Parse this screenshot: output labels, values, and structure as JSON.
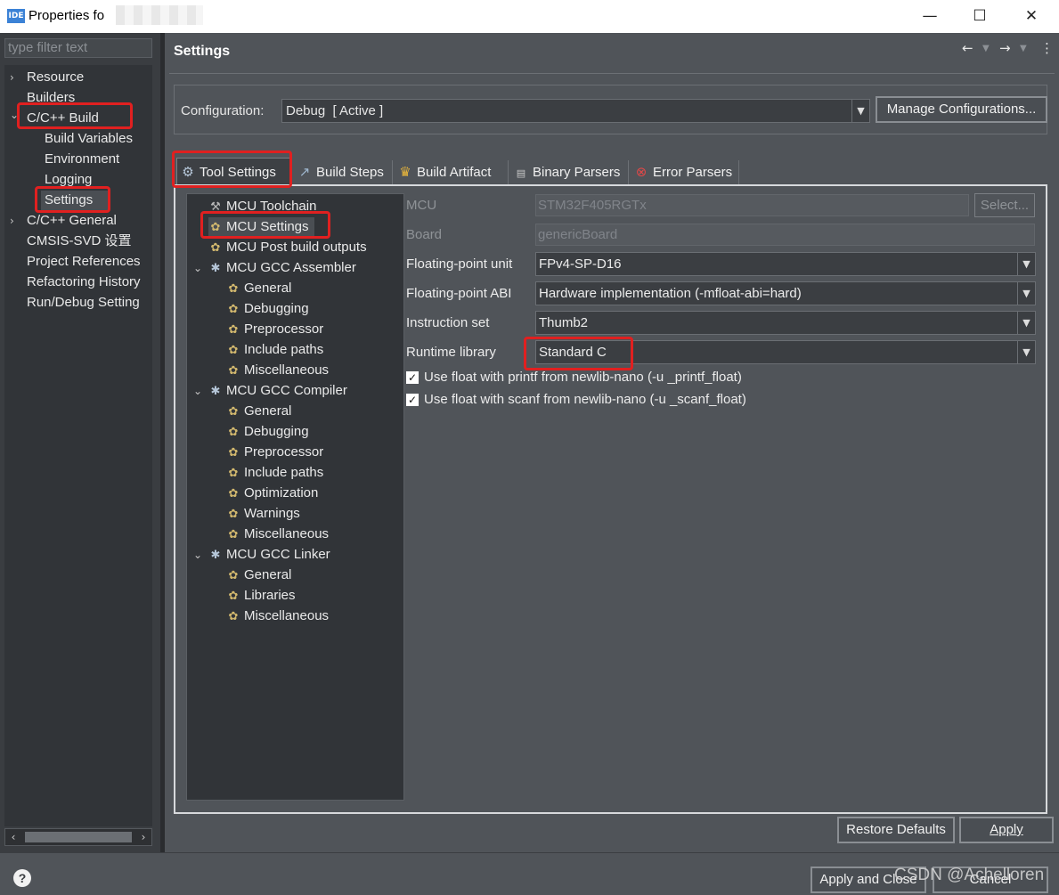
{
  "window": {
    "title": "Properties fo",
    "app_icon": "IDE",
    "controls": {
      "minimize": "—",
      "maximize": "☐",
      "close": "✕"
    }
  },
  "left": {
    "filter_placeholder": "type filter text",
    "items": [
      {
        "label": "Resource",
        "twisty": "›"
      },
      {
        "label": "Builders",
        "twisty": ""
      },
      {
        "label": "C/C++ Build",
        "twisty": "⌄"
      },
      {
        "label": "Build Variables",
        "twisty": ""
      },
      {
        "label": "Environment",
        "twisty": ""
      },
      {
        "label": "Logging",
        "twisty": ""
      },
      {
        "label": "Settings",
        "twisty": ""
      },
      {
        "label": "C/C++ General",
        "twisty": "›"
      },
      {
        "label": "CMSIS-SVD 设置",
        "twisty": ""
      },
      {
        "label": "Project References",
        "twisty": ""
      },
      {
        "label": "Refactoring History",
        "twisty": ""
      },
      {
        "label": "Run/Debug Setting",
        "twisty": ""
      }
    ]
  },
  "header": {
    "title": "Settings",
    "icons": [
      "back-arrow-icon",
      "forward-arrow-icon",
      "view-menu-icon"
    ]
  },
  "configuration": {
    "label": "Configuration:",
    "value": "Debug  [ Active ]",
    "manage_button": "Manage Configurations..."
  },
  "tabs": [
    {
      "label": "Tool Settings",
      "icon": "tool-settings-icon",
      "active": true
    },
    {
      "label": "Build Steps",
      "icon": "build-steps-icon",
      "active": false
    },
    {
      "label": "Build Artifact",
      "icon": "build-artifact-icon",
      "active": false
    },
    {
      "label": "Binary Parsers",
      "icon": "binary-parsers-icon",
      "active": false
    },
    {
      "label": "Error Parsers",
      "icon": "error-parsers-icon",
      "active": false
    }
  ],
  "tool_tree": [
    {
      "label": "MCU Toolchain",
      "icon": "hammer",
      "depth": 1,
      "twisty": ""
    },
    {
      "label": "MCU Settings",
      "icon": "gear",
      "depth": 1,
      "twisty": ""
    },
    {
      "label": "MCU Post build outputs",
      "icon": "gear",
      "depth": 1,
      "twisty": ""
    },
    {
      "label": "MCU GCC Assembler",
      "icon": "cog",
      "depth": 1,
      "twisty": "⌄"
    },
    {
      "label": "General",
      "icon": "gear",
      "depth": 2,
      "twisty": ""
    },
    {
      "label": "Debugging",
      "icon": "gear",
      "depth": 2,
      "twisty": ""
    },
    {
      "label": "Preprocessor",
      "icon": "gear",
      "depth": 2,
      "twisty": ""
    },
    {
      "label": "Include paths",
      "icon": "gear",
      "depth": 2,
      "twisty": ""
    },
    {
      "label": "Miscellaneous",
      "icon": "gear",
      "depth": 2,
      "twisty": ""
    },
    {
      "label": "MCU GCC Compiler",
      "icon": "cog",
      "depth": 1,
      "twisty": "⌄"
    },
    {
      "label": "General",
      "icon": "gear",
      "depth": 2,
      "twisty": ""
    },
    {
      "label": "Debugging",
      "icon": "gear",
      "depth": 2,
      "twisty": ""
    },
    {
      "label": "Preprocessor",
      "icon": "gear",
      "depth": 2,
      "twisty": ""
    },
    {
      "label": "Include paths",
      "icon": "gear",
      "depth": 2,
      "twisty": ""
    },
    {
      "label": "Optimization",
      "icon": "gear",
      "depth": 2,
      "twisty": ""
    },
    {
      "label": "Warnings",
      "icon": "gear",
      "depth": 2,
      "twisty": ""
    },
    {
      "label": "Miscellaneous",
      "icon": "gear",
      "depth": 2,
      "twisty": ""
    },
    {
      "label": "MCU GCC Linker",
      "icon": "cog",
      "depth": 1,
      "twisty": "⌄"
    },
    {
      "label": "General",
      "icon": "gear",
      "depth": 2,
      "twisty": ""
    },
    {
      "label": "Libraries",
      "icon": "gear",
      "depth": 2,
      "twisty": ""
    },
    {
      "label": "Miscellaneous",
      "icon": "gear",
      "depth": 2,
      "twisty": ""
    }
  ],
  "form": {
    "mcu": {
      "label": "MCU",
      "value": "STM32F405RGTx",
      "select_button": "Select..."
    },
    "board": {
      "label": "Board",
      "value": "genericBoard"
    },
    "fpu": {
      "label": "Floating-point unit",
      "value": "FPv4-SP-D16"
    },
    "fabi": {
      "label": "Floating-point ABI",
      "value": "Hardware implementation (-mfloat-abi=hard)"
    },
    "iset": {
      "label": "Instruction set",
      "value": "Thumb2"
    },
    "runtime": {
      "label": "Runtime library",
      "value": "Standard C"
    },
    "printf_float": {
      "label": "Use float with printf from newlib-nano (-u _printf_float)",
      "checked": true
    },
    "scanf_float": {
      "label": "Use float with scanf from newlib-nano (-u _scanf_float)",
      "checked": true
    }
  },
  "buttons": {
    "restore_defaults": "Restore Defaults",
    "apply": "Apply",
    "apply_and_close": "Apply and Close",
    "cancel": "Cancel"
  },
  "watermark": "CSDN @Achelloren",
  "colors": {
    "highlight": "#e02020",
    "panel": "#505459",
    "tree_bg": "#313438"
  }
}
